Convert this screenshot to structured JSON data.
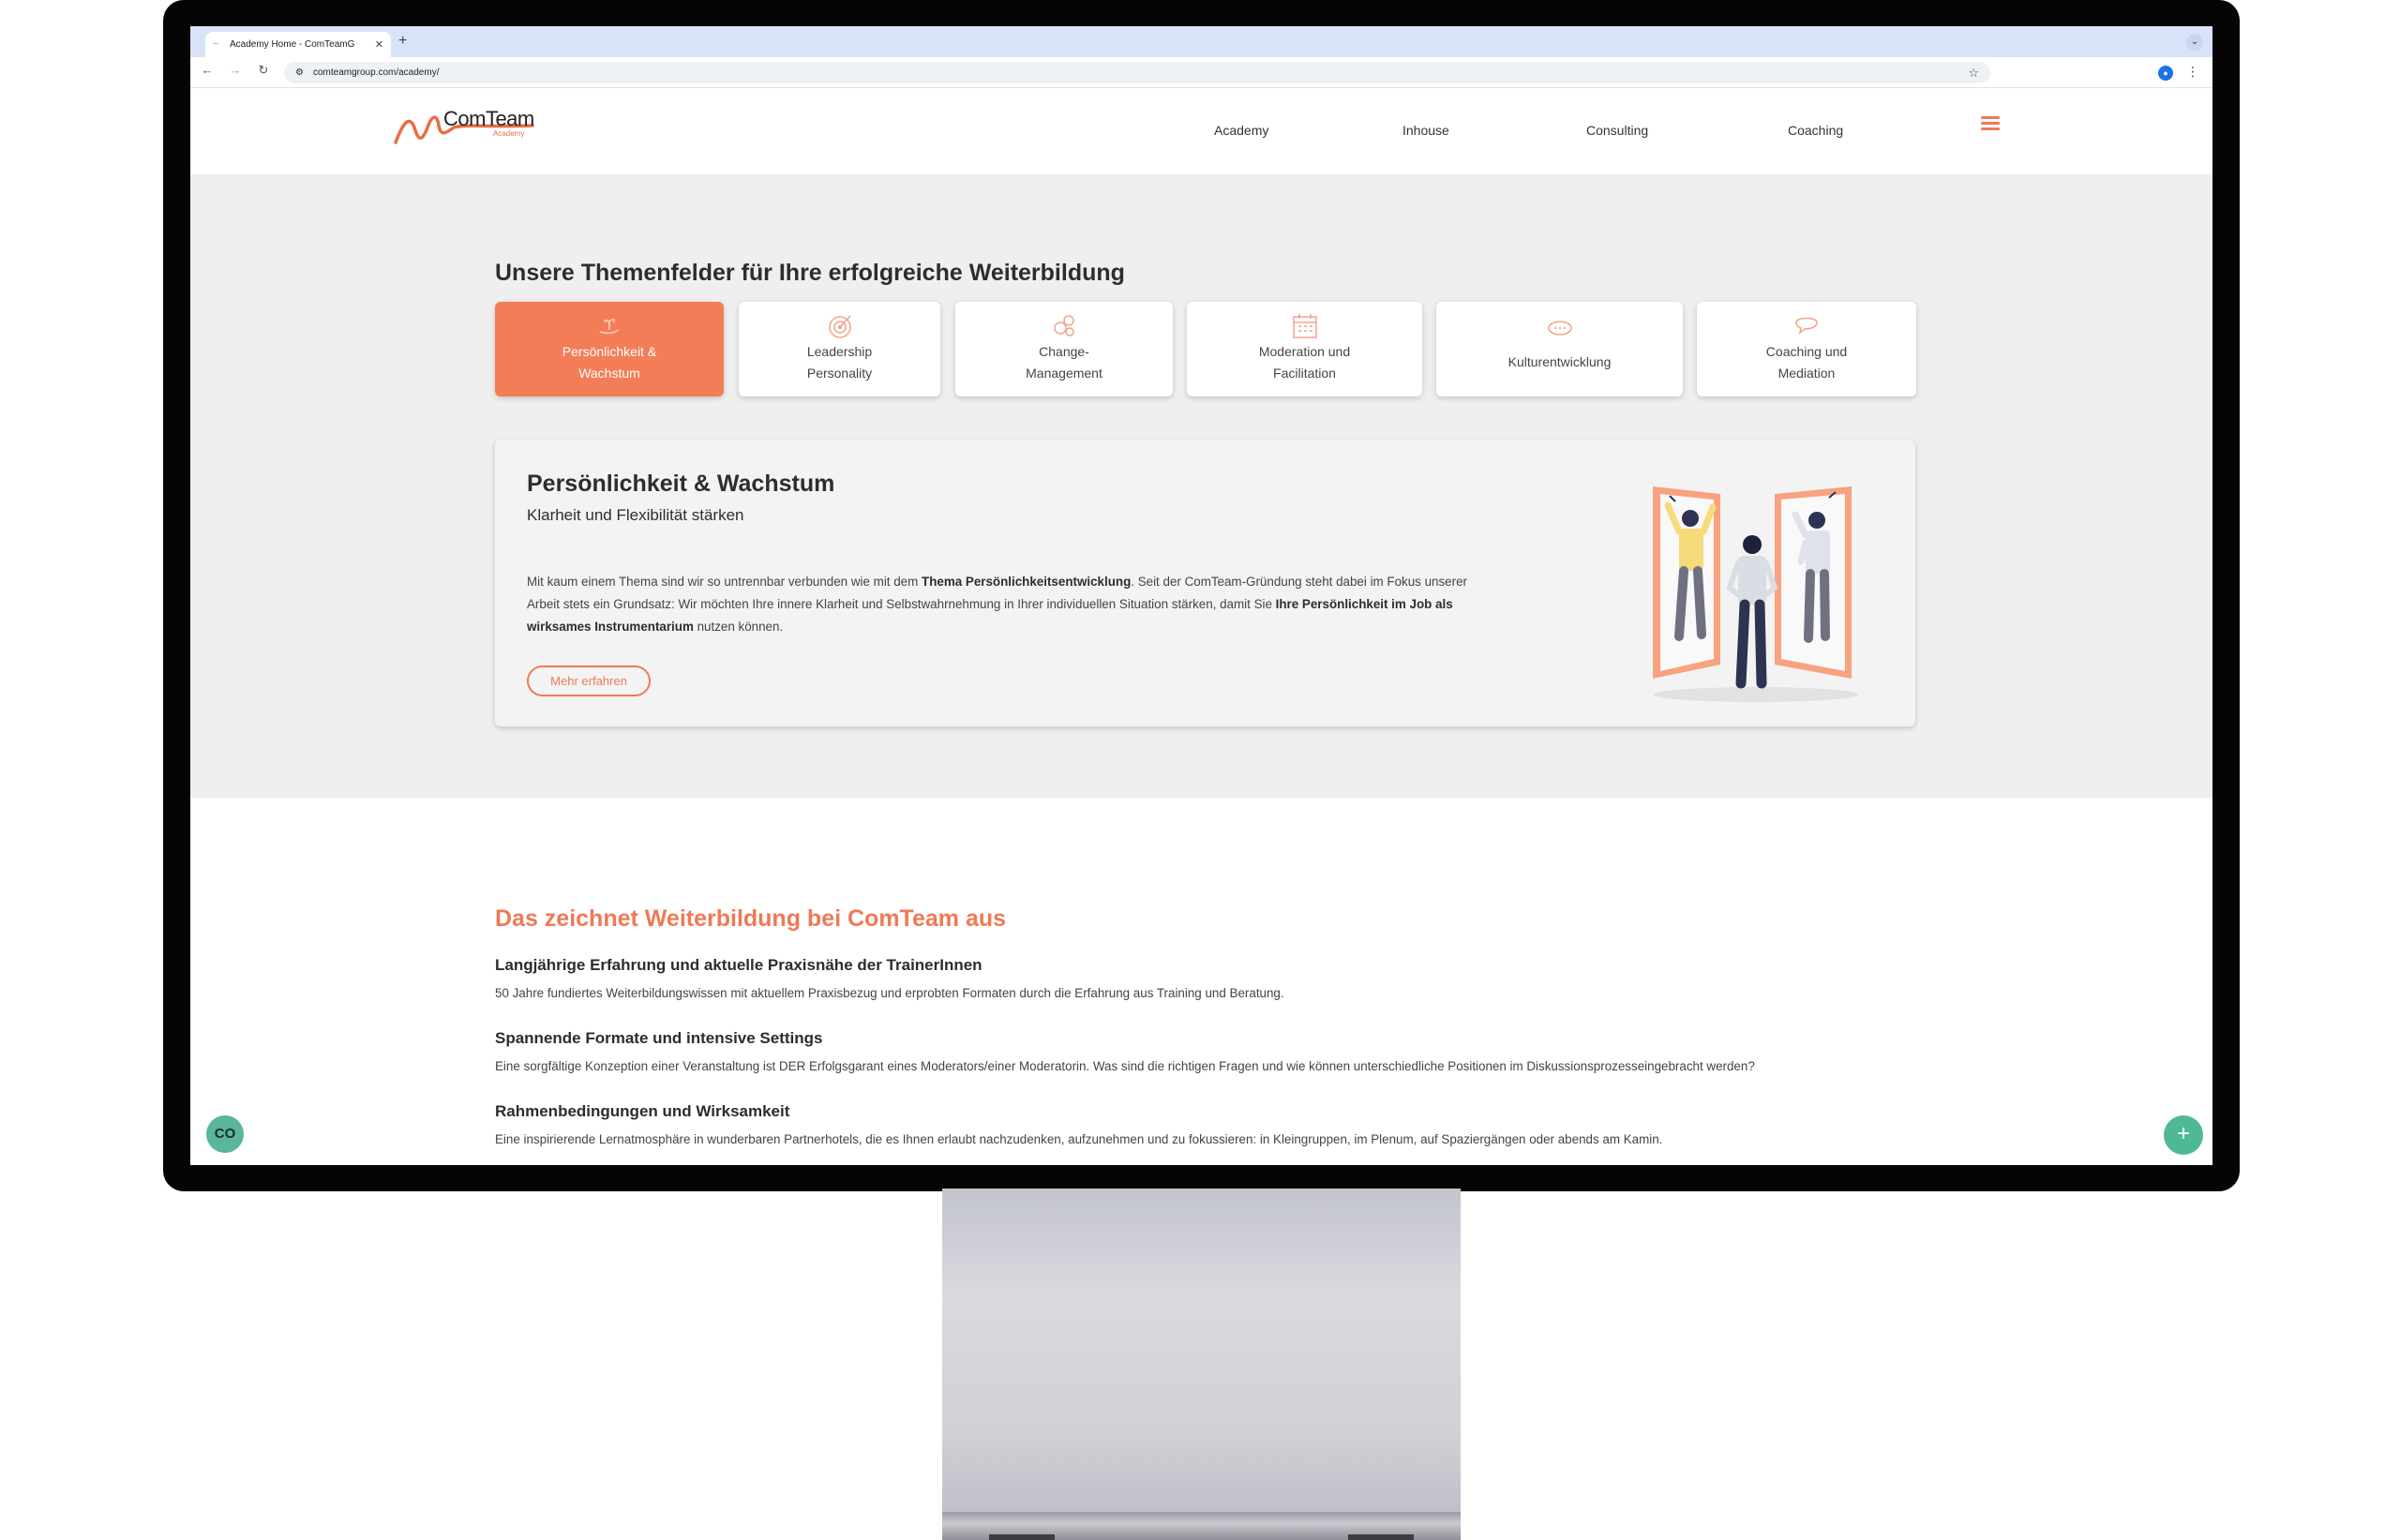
{
  "browser": {
    "tab_title": "Academy Home - ComTeamG",
    "tab_close": "✕",
    "new_tab": "+",
    "url": "comteamgroup.com/academy/",
    "tab_menu_icon": "⌄",
    "nav_back": "←",
    "nav_forward": "→",
    "nav_reload": "↻",
    "site_info_icon": "⚙",
    "bookmark_icon": "☆",
    "profile_icon": "👤",
    "menu_icon": "⋮"
  },
  "header": {
    "logo_text": "ComTeam",
    "logo_sub": "Academy",
    "nav": [
      {
        "label": "Academy"
      },
      {
        "label": "Inhouse"
      },
      {
        "label": "Consulting"
      },
      {
        "label": "Coaching"
      }
    ],
    "menu_icon": "hamburger-icon",
    "accent_color": "#ef7a55"
  },
  "topics": {
    "title": "Unsere Themenfelder für Ihre erfolgreiche Weiterbildung",
    "cards": [
      {
        "label": "Persönlichkeit &\nWachstum",
        "icon": "hand-sprout-icon",
        "active": true
      },
      {
        "label": "Leadership\nPersonality",
        "icon": "target-icon",
        "active": false
      },
      {
        "label": "Change-\nManagement",
        "icon": "gears-icon",
        "active": false
      },
      {
        "label": "Moderation und\nFacilitation",
        "icon": "calendar-icon",
        "active": false
      },
      {
        "label": "Kulturentwicklung",
        "icon": "chat-bubbles-icon",
        "active": false
      },
      {
        "label": "Coaching und\nMediation",
        "icon": "speech-bubble-icon",
        "active": false
      }
    ]
  },
  "panel": {
    "title": "Persönlichkeit & Wachstum",
    "subtitle": "Klarheit und Flexibilität stärken",
    "body_1": "Mit kaum einem Thema sind wir so untrennbar verbunden wie mit dem ",
    "body_bold_1": "Thema Persönlichkeitsentwicklung",
    "body_2": ". Seit der ComTeam-Gründung steht dabei im Fokus unserer Arbeit stets ein Grundsatz: Wir möchten Ihre innere Klarheit und Selbstwahrnehmung in Ihrer individuellen Situation stärken, damit Sie ",
    "body_bold_2": "Ihre Persönlichkeit im Job als wirksames Instrumentarium",
    "body_3": " nutzen können.",
    "button": "Mehr erfahren"
  },
  "features": {
    "title": "Das zeichnet Weiterbildung bei ComTeam aus",
    "items": [
      {
        "heading": "Langjährige Erfahrung und aktuelle Praxisnähe der TrainerInnen",
        "text": "50 Jahre fundiertes Weiterbildungswissen mit aktuellem Praxisbezug und erprobten Formaten durch die Erfahrung aus Training und Beratung."
      },
      {
        "heading": "Spannende Formate und intensive Settings",
        "text": "Eine sorgfältige Konzeption einer Veranstaltung ist DER Erfolgsgarant eines Moderators/einer Moderatorin. Was sind die richtigen Fragen und wie können unterschiedliche Positionen im Diskussionsprozesseingebracht werden?"
      },
      {
        "heading": "Rahmenbedingungen und Wirksamkeit",
        "text": "Eine inspirierende Lernatmosphäre in wunderbaren Partnerhotels, die es Ihnen erlaubt nachzudenken, aufzunehmen und zu fokussieren: in Kleingruppen, im Plenum, auf Spaziergängen oder abends am Kamin."
      }
    ]
  },
  "widgets": {
    "left_icon": "CO",
    "right_icon": "+"
  }
}
